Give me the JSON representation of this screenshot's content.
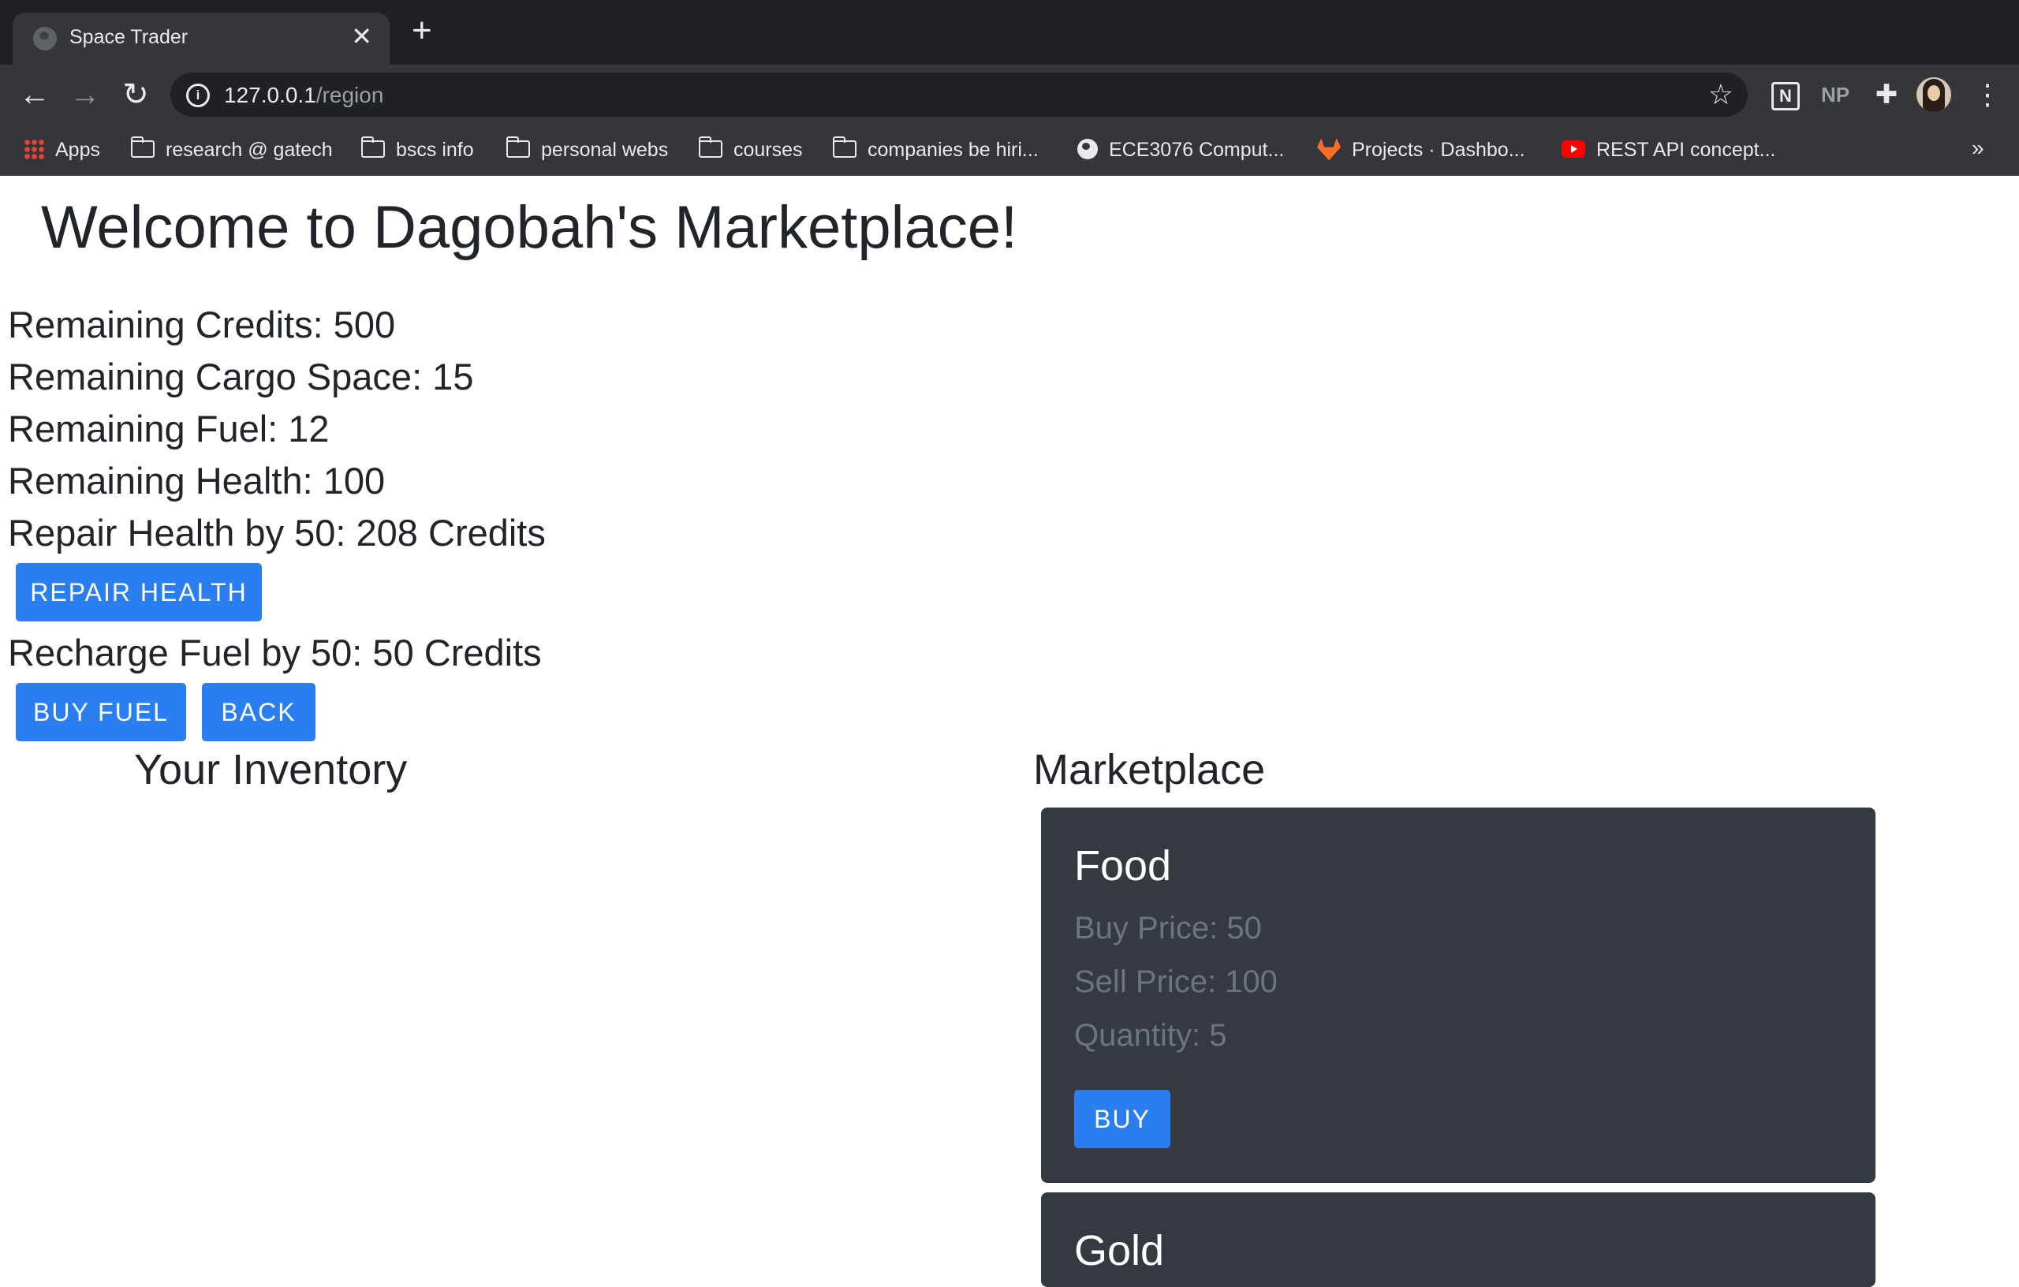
{
  "browser": {
    "tab_title": "Space Trader",
    "close_glyph": "✕",
    "new_tab_glyph": "+",
    "nav": {
      "back": "←",
      "forward": "→",
      "reload": "↻"
    },
    "url_host": "127.0.0.1",
    "url_path": "/region",
    "star_glyph": "☆",
    "extensions": {
      "notion": "N",
      "np": "NP",
      "puzzle": "✚"
    },
    "menu_glyph": "⋮",
    "bookmarks": [
      "Apps",
      "research @ gatech",
      "bscs info",
      "personal webs",
      "courses",
      "companies be hiri...",
      "ECE3076 Comput...",
      "Projects · Dashbo...",
      "REST API concept..."
    ],
    "bookmarks_overflow": "»"
  },
  "page": {
    "title": "Welcome to Dagobah's Marketplace!",
    "stats": {
      "credits": "Remaining Credits: 500",
      "cargo": "Remaining Cargo Space: 15",
      "fuel": "Remaining Fuel: 12",
      "health": "Remaining Health: 100",
      "repair_offer": "Repair Health by 50: 208 Credits",
      "recharge_offer": "Recharge Fuel by 50: 50 Credits"
    },
    "buttons": {
      "repair": "REPAIR HEALTH",
      "buy_fuel": "BUY FUEL",
      "back": "BACK"
    },
    "inventory_title": "Your Inventory",
    "marketplace_title": "Marketplace",
    "items": [
      {
        "name": "Food",
        "buy_price": "Buy Price: 50",
        "sell_price": "Sell Price: 100",
        "quantity": "Quantity: 5",
        "buy_label": "BUY"
      },
      {
        "name": "Gold"
      }
    ]
  },
  "colors": {
    "accent_button": "#2a7ef0",
    "card_background": "#343a40",
    "muted_text": "#6c757d",
    "chrome_dark": "#202124",
    "chrome_toolbar": "#35363a"
  }
}
